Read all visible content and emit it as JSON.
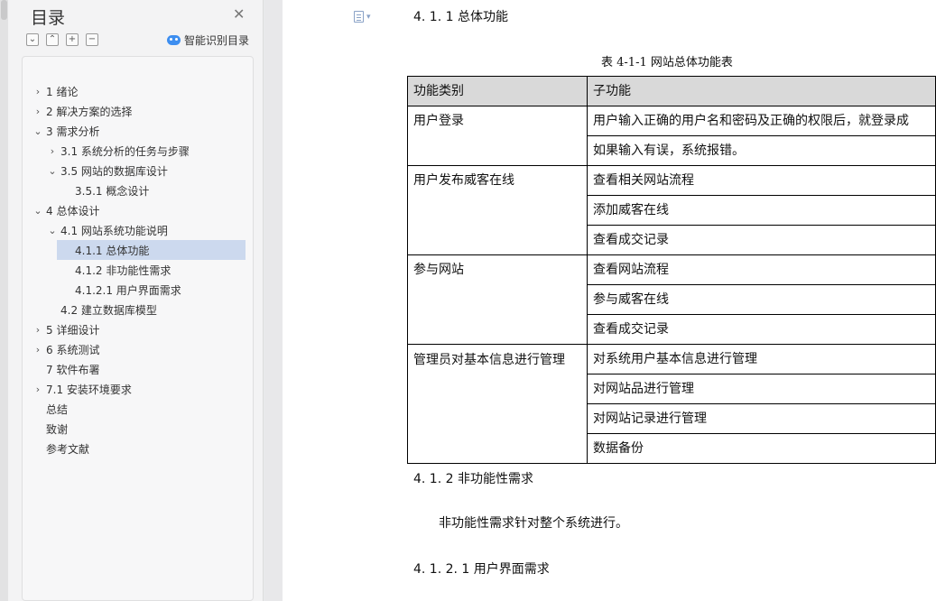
{
  "sidebar": {
    "title": "目录",
    "close_icon": "close-icon",
    "tools": [
      "collapse-all-icon",
      "expand-up-icon",
      "add-icon",
      "remove-icon"
    ],
    "smart_toc_label": "智能识别目录",
    "items": [
      {
        "label": "1  绪论",
        "chevron": "›"
      },
      {
        "label": "2  解决方案的选择",
        "chevron": "›"
      },
      {
        "label": "3  需求分析",
        "chevron": "⌄"
      },
      {
        "label": "3.1 系统分析的任务与步骤",
        "chevron": "›"
      },
      {
        "label": "3.5 网站的数据库设计",
        "chevron": "⌄"
      },
      {
        "label": "3.5.1  概念设计",
        "chevron": ""
      },
      {
        "label": "4  总体设计",
        "chevron": "⌄"
      },
      {
        "label": "4.1  网站系统功能说明",
        "chevron": "⌄"
      },
      {
        "label": "4.1.1 总体功能",
        "chevron": ""
      },
      {
        "label": "4.1.2 非功能性需求",
        "chevron": ""
      },
      {
        "label": "4.1.2.1 用户界面需求",
        "chevron": ""
      },
      {
        "label": "4.2  建立数据库模型",
        "chevron": ""
      },
      {
        "label": "5  详细设计",
        "chevron": "›"
      },
      {
        "label": "6  系统测试",
        "chevron": "›"
      },
      {
        "label": "7  软件布署",
        "chevron": ""
      },
      {
        "label": "7.1 安装环境要求",
        "chevron": "›"
      },
      {
        "label": "总结",
        "chevron": ""
      },
      {
        "label": "致谢",
        "chevron": ""
      },
      {
        "label": "参考文献",
        "chevron": ""
      }
    ]
  },
  "document": {
    "heading_411": "4. 1. 1 总体功能",
    "table_caption": "表 4-1-1  网站总体功能表",
    "table_headers": [
      "功能类别",
      "子功能"
    ],
    "table_groups": [
      {
        "category": "用户登录",
        "subs": [
          "用户输入正确的用户名和密码及正确的权限后，就登录成",
          "如果输入有误，系统报错。"
        ]
      },
      {
        "category": "用户发布威客在线",
        "subs": [
          "查看相关网站流程",
          "添加威客在线",
          "查看成交记录"
        ]
      },
      {
        "category": "参与网站",
        "subs": [
          "查看网站流程",
          "参与威客在线",
          "查看成交记录"
        ]
      },
      {
        "category": "管理员对基本信息进行管理",
        "subs": [
          "对系统用户基本信息进行管理",
          "对网站品进行管理",
          "对网站记录进行管理",
          "数据备份"
        ]
      }
    ],
    "heading_412": "4. 1. 2 非功能性需求",
    "paragraph_412": "非功能性需求针对整个系统进行。",
    "heading_4121": "4. 1. 2. 1 用户界面需求"
  }
}
